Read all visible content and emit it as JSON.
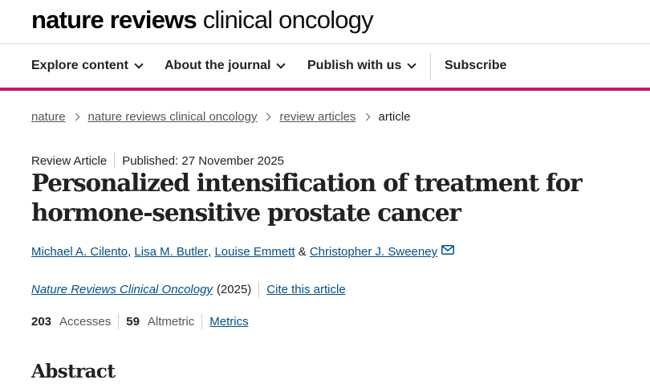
{
  "masthead": {
    "logo_bold": "nature reviews",
    "logo_light": "clinical oncology"
  },
  "nav": {
    "items": [
      {
        "label": "Explore content"
      },
      {
        "label": "About the journal"
      },
      {
        "label": "Publish with us"
      }
    ],
    "subscribe": "Subscribe"
  },
  "breadcrumb": [
    "nature",
    "nature reviews clinical oncology",
    "review articles",
    "article"
  ],
  "article": {
    "type": "Review Article",
    "published": "Published: 27 November 2025",
    "title": "Personalized intensification of treatment for hormone-sensitive prostate cancer",
    "authors": [
      "Michael A. Cilento",
      "Lisa M. Butler",
      "Louise Emmett",
      "Christopher J. Sweeney"
    ],
    "journal": "Nature Reviews Clinical Oncology",
    "year": "(2025)",
    "cite_label": "Cite this article",
    "accesses_value": "203",
    "accesses_label": "Accesses",
    "altmetric_value": "59",
    "altmetric_label": "Altmetric",
    "metrics_label": "Metrics"
  },
  "sections": {
    "abstract_heading": "Abstract"
  },
  "colors": {
    "accent": "#c4166d",
    "link": "#00508a"
  }
}
